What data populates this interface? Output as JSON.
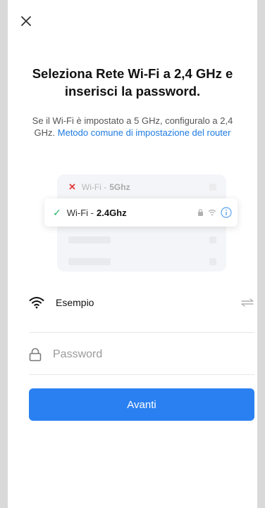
{
  "header": {
    "close_icon": "close-icon",
    "title": "Seleziona Rete Wi-Fi a 2,4 GHz e inserisci la password.",
    "subtitle_text": "Se il Wi-Fi è impostato a 5 GHz, configuralo a 2,4 GHz. ",
    "subtitle_link": "Metodo comune di impostazione del router"
  },
  "illustration": {
    "network_5g": {
      "label": "Wi-Fi - ",
      "band": "5Ghz",
      "status": "invalid"
    },
    "network_24g": {
      "label": "Wi-Fi - ",
      "band": "2.4Ghz",
      "status": "valid"
    }
  },
  "form": {
    "ssid_value": "Esempio",
    "password_placeholder": "Password",
    "next_label": "Avanti"
  },
  "colors": {
    "primary": "#2a80f1",
    "link": "#1f7be0",
    "error": "#e5393a",
    "success": "#2bb36b"
  }
}
